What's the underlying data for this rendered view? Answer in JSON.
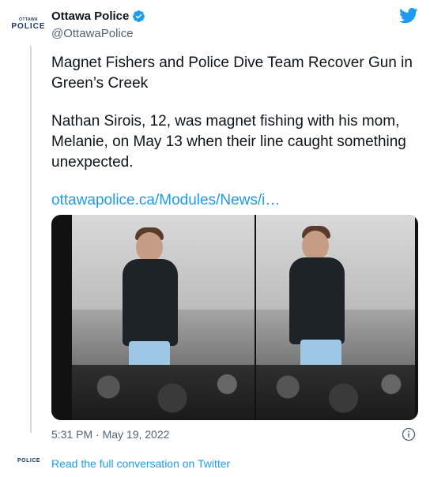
{
  "author": {
    "logo_small": "OTTAWA",
    "logo_big": "POLICE",
    "name": "Ottawa Police",
    "handle": "@OttawaPolice"
  },
  "tweet": {
    "headline": "Magnet Fishers and Police Dive Team Recover Gun in Green’s Creek",
    "body": "Nathan Sirois, 12, was magnet fishing with his mom, Melanie, on May 13 when their line caught something unexpected.",
    "link": "ottawapolice.ca/Modules/News/i…"
  },
  "meta": {
    "timestamp": "5:31 PM · May 19, 2022"
  },
  "footer": {
    "mini_logo": "POLICE",
    "read_more": "Read the full conversation on Twitter"
  },
  "colors": {
    "link": "#1d9bf0",
    "verified": "#1d9bf0",
    "twitter_blue": "#1d9bf0"
  },
  "icons": [
    "verified-badge-icon",
    "twitter-bird-icon",
    "info-icon"
  ]
}
